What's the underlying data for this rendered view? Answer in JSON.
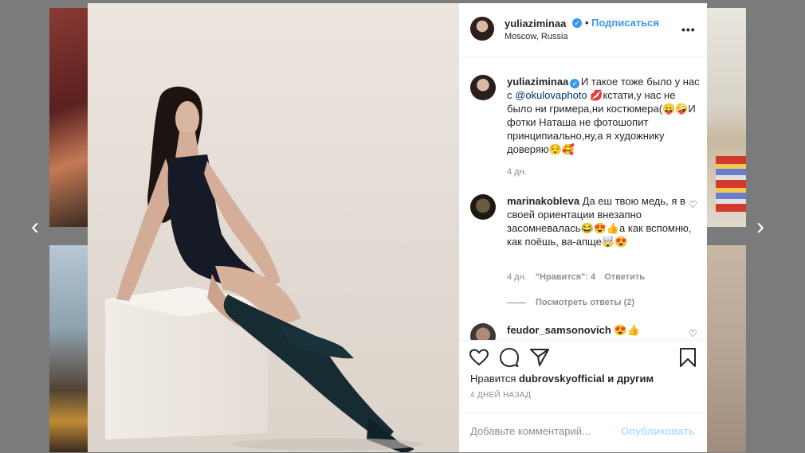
{
  "nav": {
    "prev_icon": "‹",
    "next_icon": "›"
  },
  "post": {
    "owner": "yuliaziminaa",
    "verified_icon": "✓",
    "dot": "•",
    "follow_label": "Подписаться",
    "location": "Moscow, Russia",
    "more_icon": "•••"
  },
  "caption": {
    "user": "yuliaziminaa",
    "text_before": " И такое тоже было у нас с ",
    "mention": "@okulovaphoto",
    "text_after": " 💋кстати,у нас не было ни гримера,ни костюмера(😛🤪И фотки Наташа не фотошопит принципиально,ну,а я художнику доверяю😌🥰",
    "age": "4 дн."
  },
  "comments": [
    {
      "user": "marinakobleva",
      "text": " Да еш твою медь, я в своей ориентации внезапно засомневалась😂😍👍а как вспомню, как поёшь, ва-апще🤯😍",
      "age": "4 дн.",
      "likes": "\"Нравится\": 4",
      "reply_label": "Ответить",
      "view_replies": "Посмотреть ответы (2)"
    },
    {
      "user": "feudor_samsonovich",
      "text": " 😍👍"
    }
  ],
  "likes": {
    "prefix": "Нравится ",
    "user": "dubrovskyofficial",
    "suffix": " и другим"
  },
  "timestamp": "4 ДНЕЙ НАЗАД",
  "add_comment": {
    "placeholder": "Добавьте комментарий...",
    "publish_label": "Опубликовать"
  },
  "colors": {
    "accent": "#3897f0",
    "publish_disabled": "#b2dffc",
    "muted": "#8e8e8e"
  }
}
